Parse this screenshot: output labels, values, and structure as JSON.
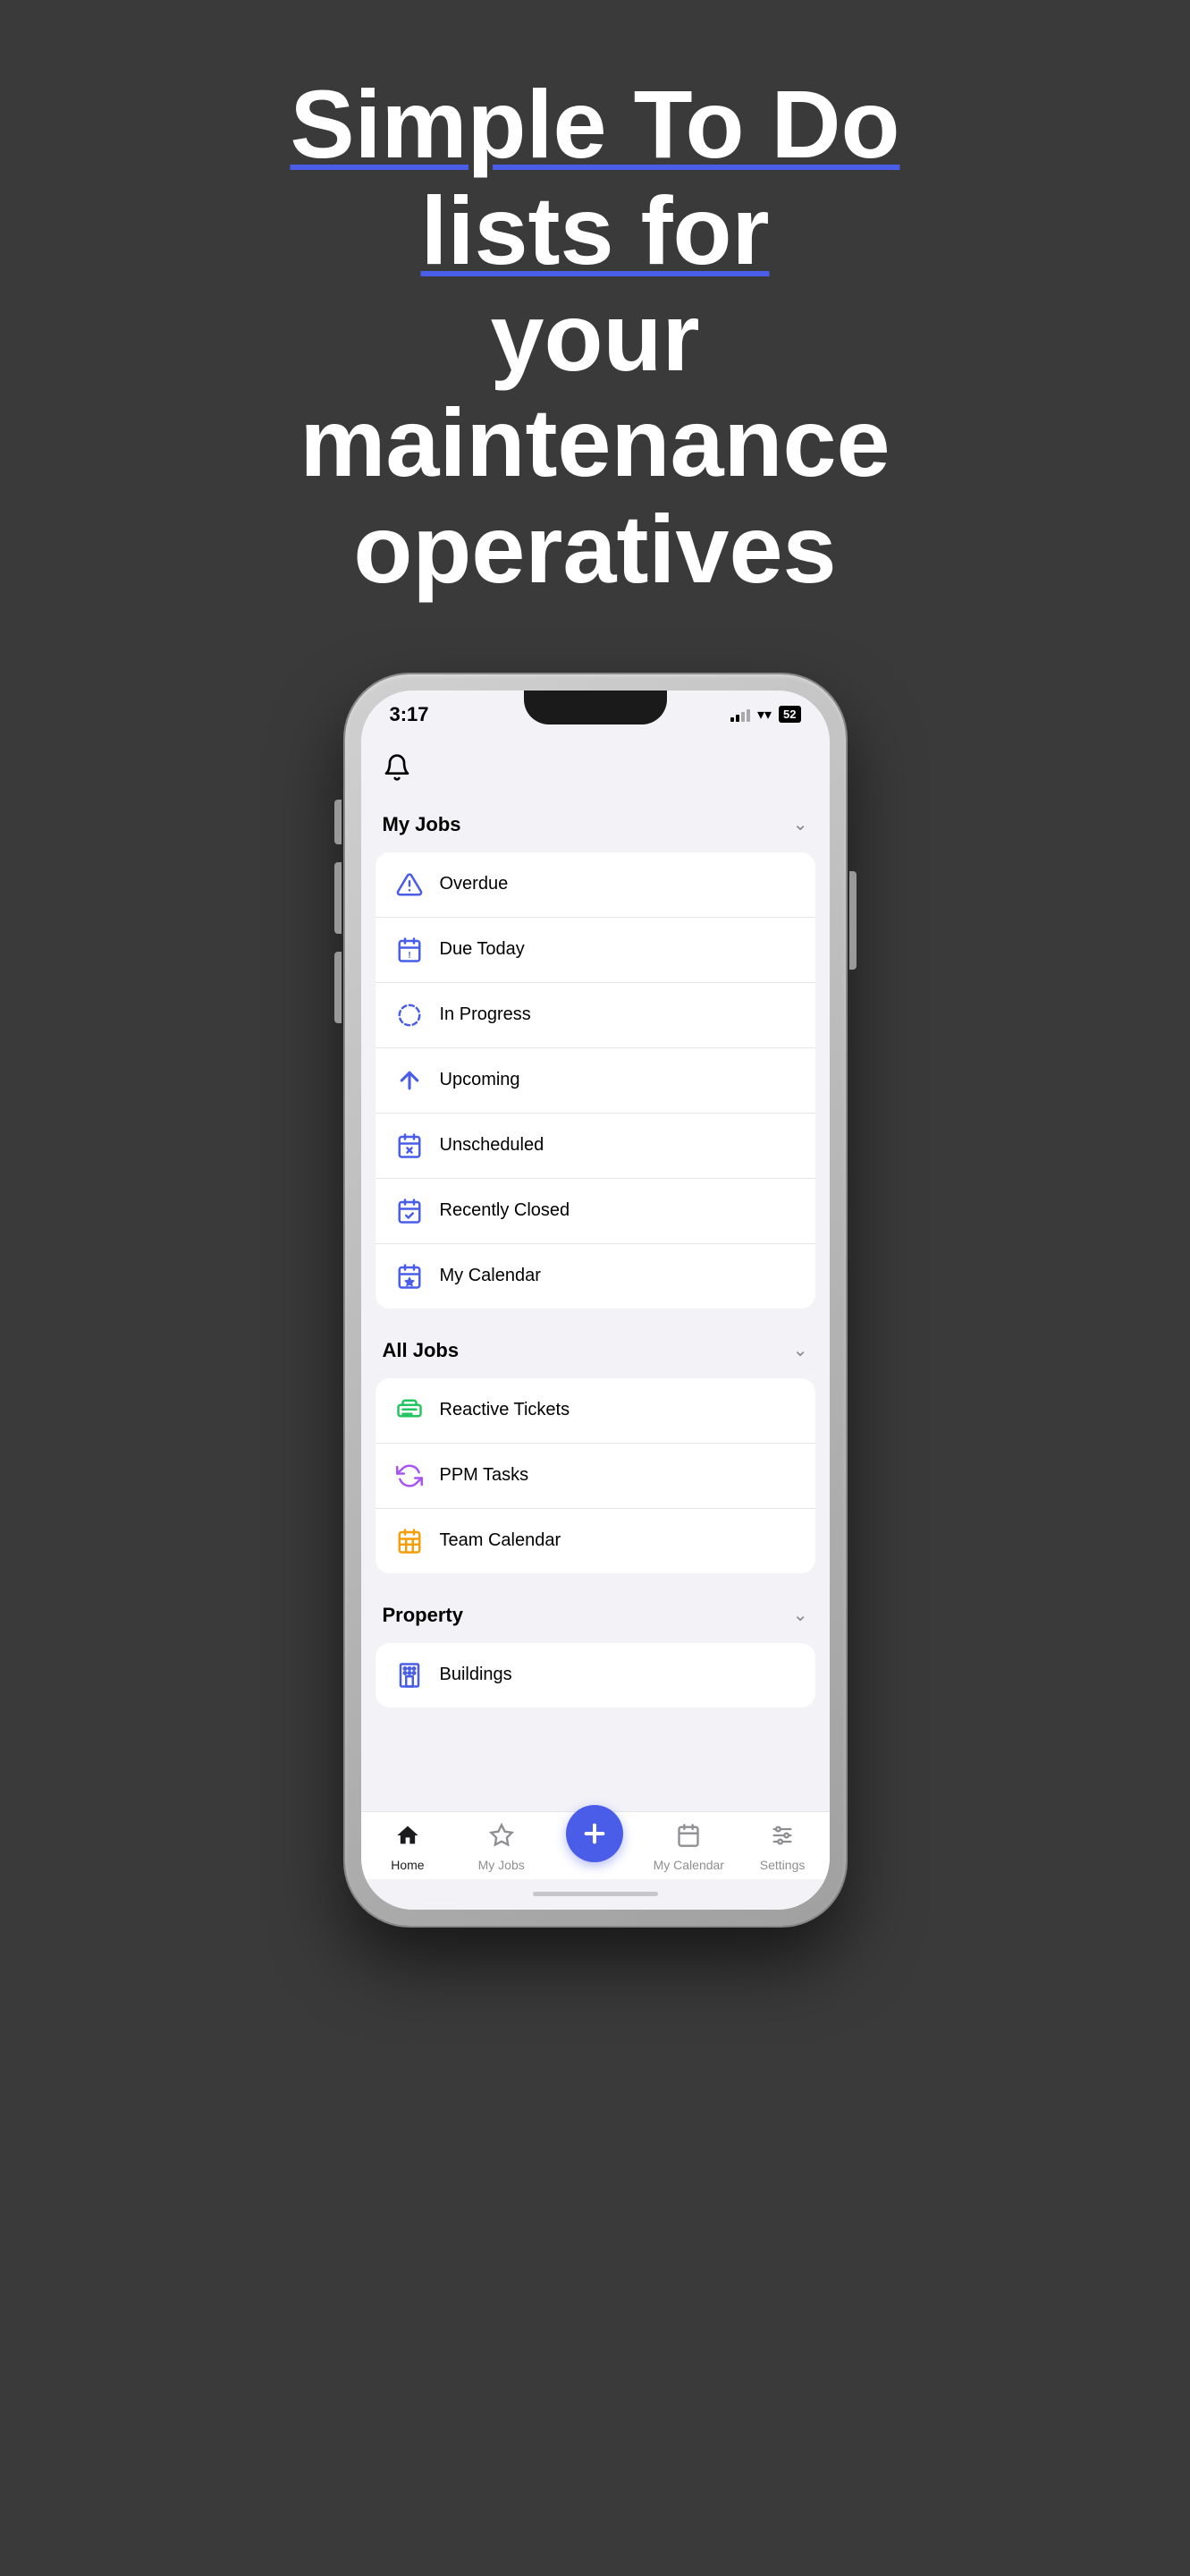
{
  "hero": {
    "line1": "Simple To Do lists for",
    "line2": "your maintenance",
    "line3": "operatives"
  },
  "phone": {
    "status": {
      "time": "3:17",
      "battery": "52"
    },
    "sections": [
      {
        "id": "my-jobs",
        "title": "My Jobs",
        "items": [
          {
            "id": "overdue",
            "label": "Overdue",
            "icon": "warning"
          },
          {
            "id": "due-today",
            "label": "Due Today",
            "icon": "calendar"
          },
          {
            "id": "in-progress",
            "label": "In Progress",
            "icon": "spinner"
          },
          {
            "id": "upcoming",
            "label": "Upcoming",
            "icon": "arrow-up"
          },
          {
            "id": "unscheduled",
            "label": "Unscheduled",
            "icon": "calendar-x"
          },
          {
            "id": "recently-closed",
            "label": "Recently Closed",
            "icon": "calendar-check"
          },
          {
            "id": "my-calendar",
            "label": "My Calendar",
            "icon": "calendar-star"
          }
        ]
      },
      {
        "id": "all-jobs",
        "title": "All Jobs",
        "items": [
          {
            "id": "reactive-tickets",
            "label": "Reactive Tickets",
            "icon": "ticket"
          },
          {
            "id": "ppm-tasks",
            "label": "PPM Tasks",
            "icon": "refresh"
          },
          {
            "id": "team-calendar",
            "label": "Team Calendar",
            "icon": "calendar-grid"
          }
        ]
      },
      {
        "id": "property",
        "title": "Property",
        "items": [
          {
            "id": "buildings",
            "label": "Buildings",
            "icon": "building"
          }
        ]
      }
    ],
    "tabBar": {
      "items": [
        {
          "id": "home",
          "label": "Home",
          "icon": "home",
          "active": true
        },
        {
          "id": "my-jobs",
          "label": "My Jobs",
          "icon": "star",
          "active": false
        },
        {
          "id": "add",
          "label": "",
          "icon": "plus",
          "isFab": true
        },
        {
          "id": "my-calendar",
          "label": "My Calendar",
          "icon": "calendar-tab",
          "active": false
        },
        {
          "id": "settings",
          "label": "Settings",
          "icon": "settings",
          "active": false
        }
      ]
    }
  }
}
